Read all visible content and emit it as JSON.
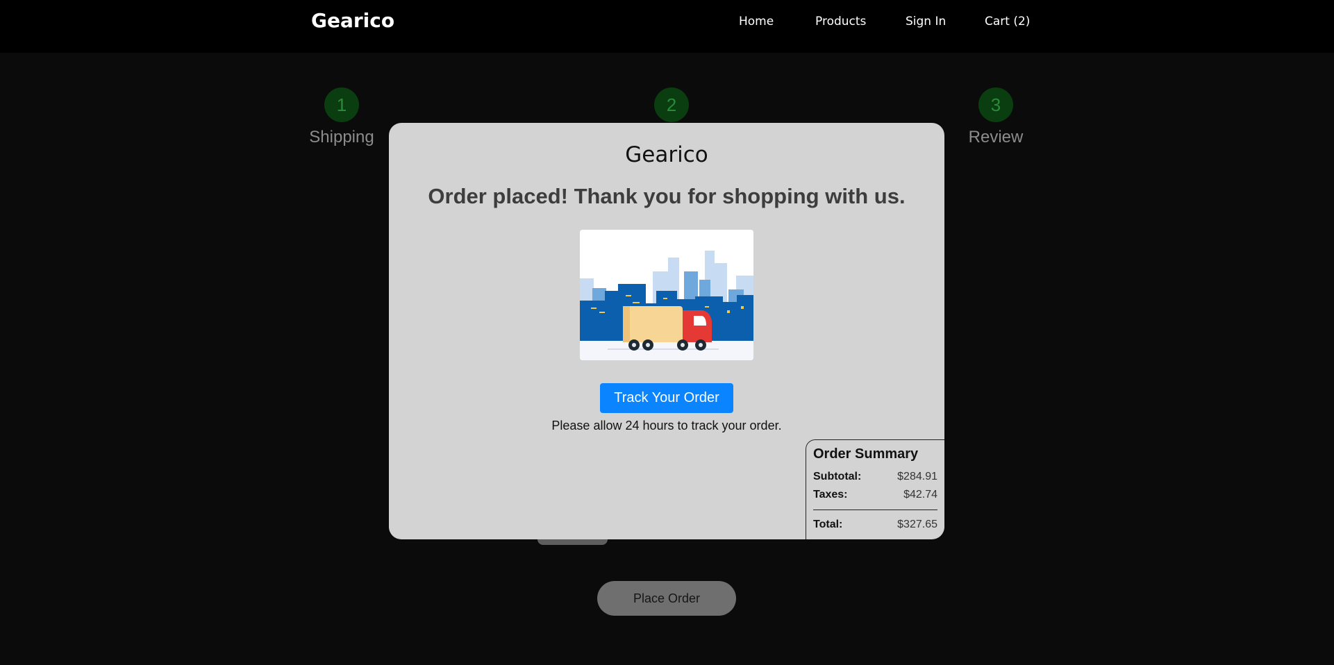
{
  "navbar": {
    "brand": "Gearico",
    "links": [
      {
        "label": "Home"
      },
      {
        "label": "Products"
      },
      {
        "label": "Sign In"
      },
      {
        "label": "Cart (2)"
      }
    ]
  },
  "steps": [
    {
      "number": "1",
      "label": "Shipping"
    },
    {
      "number": "2",
      "label": ""
    },
    {
      "number": "3",
      "label": "Review"
    }
  ],
  "checkout": {
    "place_order_label": "Place Order"
  },
  "modal": {
    "brand": "Gearico",
    "heading": "Order placed! Thank you for shopping with us.",
    "illustration": "delivery-truck-city",
    "track_button_label": "Track Your Order",
    "hint": "Please allow 24 hours to track your order.",
    "button_color": "#0a84ff"
  },
  "summary": {
    "title": "Order Summary",
    "rows": [
      {
        "label": "Subtotal:",
        "value": "$284.91"
      },
      {
        "label": "Taxes:",
        "value": "$42.74"
      }
    ],
    "total_label": "Total:",
    "total_value": "$327.65"
  }
}
